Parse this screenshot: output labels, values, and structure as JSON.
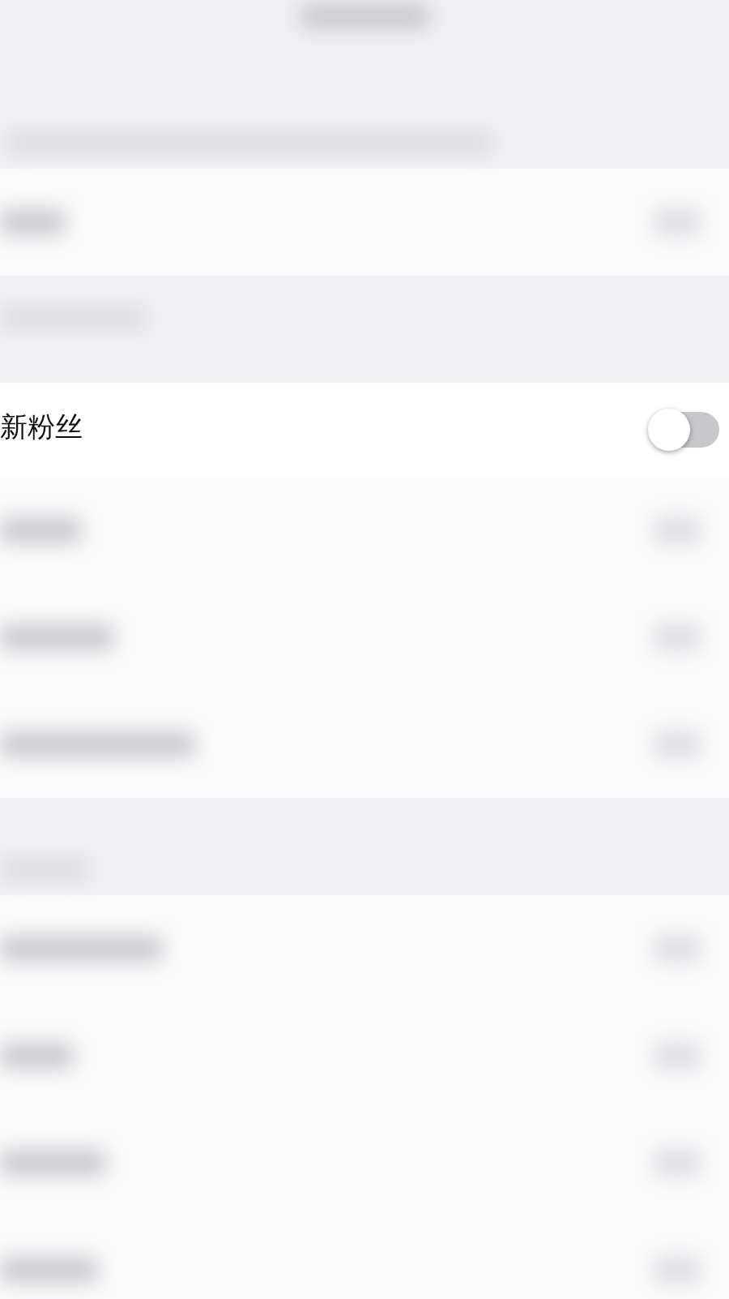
{
  "setting_row": {
    "label": "新粉丝",
    "on": false
  }
}
